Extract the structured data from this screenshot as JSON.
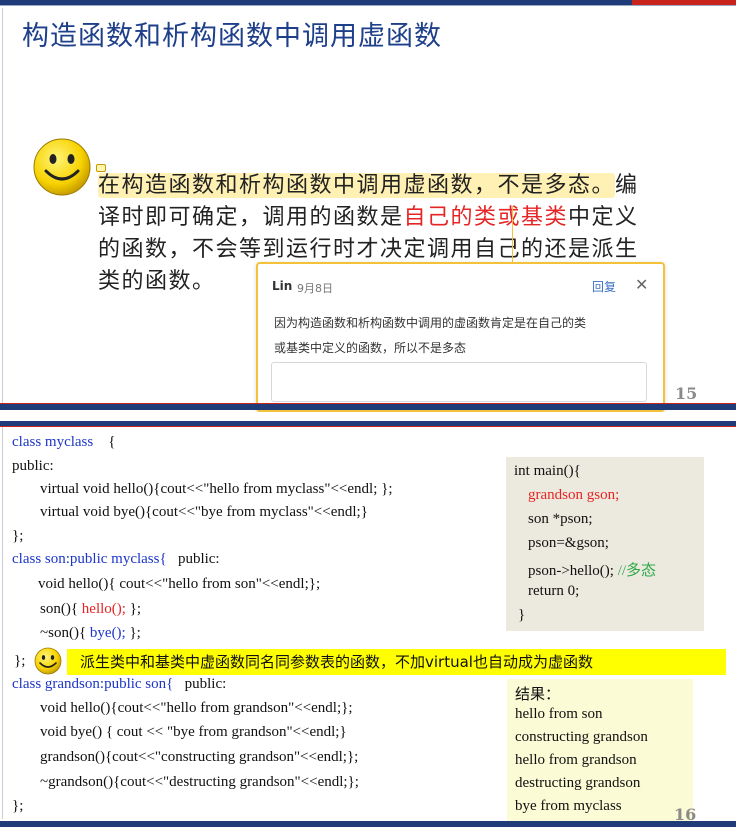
{
  "slide15": {
    "title": "构造函数和析构函数中调用虚函数",
    "para": {
      "l1_hl": "在构造函数和析构函数中调用虚函数，不是多态。",
      "l1_rest": "编",
      "l2_a": "译时即可确定，调用的函数是",
      "l2_red": "自己的类或基类",
      "l2_b": "中定义",
      "l3": "的函数，不会等到运行时才决定调用自己的还是派生",
      "l4": "类的函数。"
    },
    "page_number": "15",
    "comment": {
      "author": "Lin",
      "date": "9月8日",
      "reply_label": "回复",
      "close_label": "✕",
      "text_line1": "因为构造函数和析构函数中调用的虚函数肯定是在自己的类",
      "text_line2": "或基类中定义的函数，所以不是多态",
      "input_value": ""
    }
  },
  "slide16": {
    "code": {
      "l1_kw": "class myclass",
      "l1_rest": "    {",
      "l2": "public:",
      "l3": "virtual void hello(){cout<<\"hello from myclass\"<<endl; };",
      "l4": "virtual void bye(){cout<<\"bye from myclass\"<<endl;}",
      "l5": "};",
      "l6_kw": "class son:public myclass{",
      "l6_rest": "   public:",
      "l7": "void hello(){ cout<<\"hello from son\"<<endl;};",
      "l8_a": "son(){ ",
      "l8_red": "hello();",
      "l8_b": " };",
      "l9_a": "~son(){ ",
      "l9_blue": "bye();",
      "l9_b": " };",
      "l10": "};",
      "l11_kw": "class grandson:public son{",
      "l11_rest": "   public:",
      "l12": "void hello(){cout<<\"hello from grandson\"<<endl;};",
      "l13": "void bye() { cout << \"bye from grandson\"<<endl;}",
      "l14": "grandson(){cout<<\"constructing grandson\"<<endl;};",
      "l15": "~grandson(){cout<<\"destructing grandson\"<<endl;};",
      "l16": "};"
    },
    "main_code": {
      "l1": "int main(){",
      "l2": "grandson gson;",
      "l3": "son *pson;",
      "l4": "pson=&gson;",
      "l5_a": "pson->hello(); ",
      "l5_comment": "//多态",
      "l6": "return 0;",
      "l7": "}"
    },
    "banner_text": "派生类中和基类中虚函数同名同参数表的函数，不加virtual也自动成为虚函数",
    "result": {
      "title": "结果：",
      "lines": [
        "hello from son",
        "constructing grandson",
        "hello from grandson",
        "destructing grandson",
        "bye from myclass"
      ]
    },
    "page_number": "16"
  },
  "colors": {
    "title_blue": "#1e3f8a",
    "bar_navy": "#1f3c78",
    "accent_red": "#e52525",
    "keyword_blue": "#1d35c9",
    "comment_green": "#2ea84a",
    "banner_yellow": "#ffff00"
  },
  "icons": [
    "smiley-icon",
    "comment-marker-icon",
    "close-icon"
  ]
}
